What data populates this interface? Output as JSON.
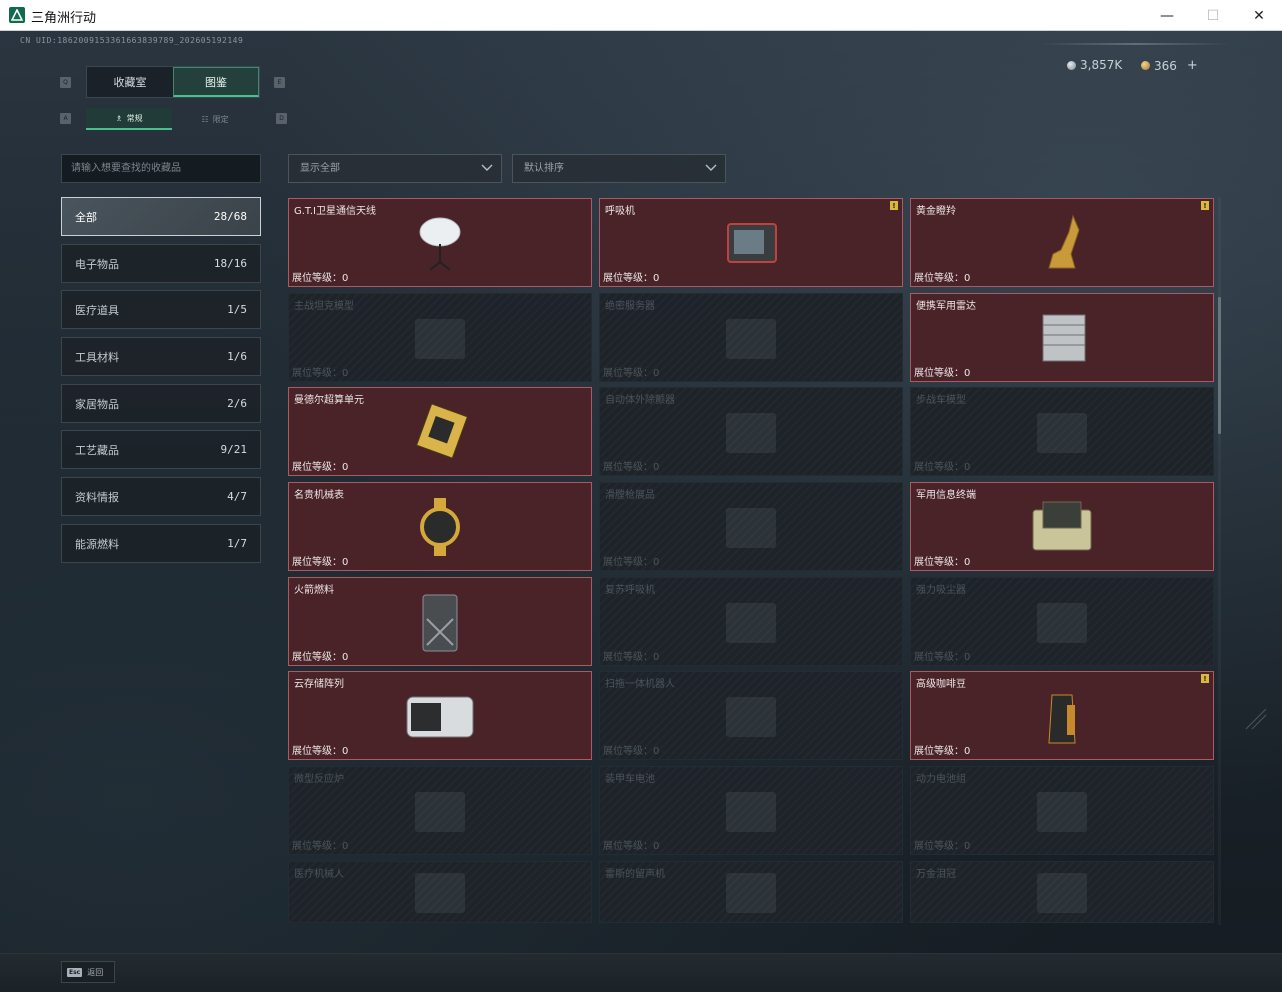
{
  "window": {
    "title": "三角洲行动",
    "minimize": "—",
    "maximize": "☐",
    "close": "✕"
  },
  "header": {
    "uid": "CN UID:1862009153361663839789_202605192149",
    "currency_a": "3,857K",
    "currency_b": "366",
    "plus": "+"
  },
  "tabs_primary": [
    {
      "label": "收藏室",
      "active": false
    },
    {
      "label": "图鉴",
      "active": true
    }
  ],
  "tabs_secondary": [
    {
      "label": "常规",
      "active": true
    },
    {
      "label": "限定",
      "active": false
    }
  ],
  "key_hints": {
    "q": "Q",
    "e": "E",
    "a": "A",
    "d": "D"
  },
  "search": {
    "placeholder": "请输入想要查找的收藏品"
  },
  "filters": {
    "display": "显示全部",
    "sort": "默认排序"
  },
  "categories": [
    {
      "label": "全部",
      "count": "28/68",
      "active": true
    },
    {
      "label": "电子物品",
      "count": "18/16",
      "active": false
    },
    {
      "label": "医疗道具",
      "count": "1/5",
      "active": false
    },
    {
      "label": "工具材料",
      "count": "1/6",
      "active": false
    },
    {
      "label": "家居物品",
      "count": "2/6",
      "active": false
    },
    {
      "label": "工艺藏品",
      "count": "9/21",
      "active": false
    },
    {
      "label": "资料情报",
      "count": "4/7",
      "active": false
    },
    {
      "label": "能源燃料",
      "count": "1/7",
      "active": false
    }
  ],
  "level_label": "展位等级：",
  "items": [
    {
      "name": "G.T.I卫星通信天线",
      "level": "0",
      "owned": true,
      "badge": false,
      "icon": "satellite-dish-icon"
    },
    {
      "name": "呼吸机",
      "level": "0",
      "owned": true,
      "badge": true,
      "icon": "ventilator-icon"
    },
    {
      "name": "黄金瞪羚",
      "level": "0",
      "owned": true,
      "badge": true,
      "icon": "golden-gazelle-icon"
    },
    {
      "name": "主战坦克模型",
      "level": "0",
      "owned": false,
      "badge": false,
      "icon": "tank-model-icon"
    },
    {
      "name": "绝密服务器",
      "level": "0",
      "owned": false,
      "badge": false,
      "icon": "server-icon"
    },
    {
      "name": "便携军用雷达",
      "level": "0",
      "owned": true,
      "badge": false,
      "icon": "radar-icon"
    },
    {
      "name": "曼德尔超算单元",
      "level": "0",
      "owned": true,
      "badge": false,
      "icon": "cpu-unit-icon"
    },
    {
      "name": "自动体外除颤器",
      "level": "0",
      "owned": false,
      "badge": false,
      "icon": "defibrillator-icon"
    },
    {
      "name": "步战车模型",
      "level": "0",
      "owned": false,
      "badge": false,
      "icon": "ifv-model-icon"
    },
    {
      "name": "名贵机械表",
      "level": "0",
      "owned": true,
      "badge": false,
      "icon": "watch-icon"
    },
    {
      "name": "滑膛枪展品",
      "level": "0",
      "owned": false,
      "badge": false,
      "icon": "musket-icon"
    },
    {
      "name": "军用信息终端",
      "level": "0",
      "owned": true,
      "badge": false,
      "icon": "terminal-icon"
    },
    {
      "name": "火箭燃料",
      "level": "0",
      "owned": true,
      "badge": false,
      "icon": "fuel-can-icon"
    },
    {
      "name": "复苏呼吸机",
      "level": "0",
      "owned": false,
      "badge": false,
      "icon": "resus-ventilator-icon"
    },
    {
      "name": "强力吸尘器",
      "level": "0",
      "owned": false,
      "badge": false,
      "icon": "vacuum-icon"
    },
    {
      "name": "云存储阵列",
      "level": "0",
      "owned": true,
      "badge": false,
      "icon": "storage-array-icon"
    },
    {
      "name": "扫拖一体机器人",
      "level": "0",
      "owned": false,
      "badge": false,
      "icon": "robot-vacuum-icon"
    },
    {
      "name": "高级咖啡豆",
      "level": "0",
      "owned": true,
      "badge": true,
      "icon": "coffee-bag-icon"
    },
    {
      "name": "微型反应炉",
      "level": "0",
      "owned": false,
      "badge": false,
      "icon": "reactor-icon"
    },
    {
      "name": "装甲车电池",
      "level": "0",
      "owned": false,
      "badge": false,
      "icon": "battery-icon"
    },
    {
      "name": "动力电池组",
      "level": "0",
      "owned": false,
      "badge": false,
      "icon": "battery-pack-icon"
    },
    {
      "name": "医疗机械人",
      "level": "",
      "owned": false,
      "badge": false,
      "icon": "medical-robot-icon"
    },
    {
      "name": "雷斯的留声机",
      "level": "",
      "owned": false,
      "badge": false,
      "icon": "gramophone-icon"
    },
    {
      "name": "万金泪冠",
      "level": "",
      "owned": false,
      "badge": false,
      "icon": "crown-icon"
    }
  ],
  "footer": {
    "esc_key": "Esc",
    "back": "返回"
  },
  "colors": {
    "owned_bg": "#4a2328",
    "owned_border": "#a95a63",
    "accent_green": "#47c08e",
    "badge_yellow": "#d9b841"
  }
}
